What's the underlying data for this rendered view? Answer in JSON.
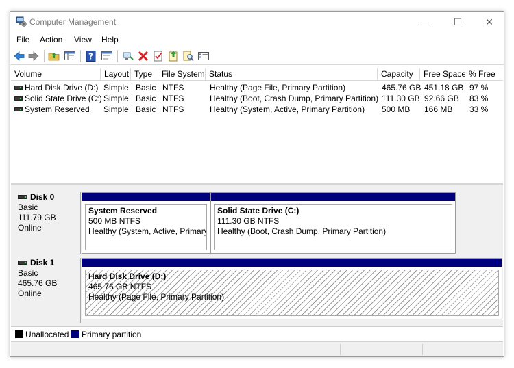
{
  "window": {
    "title": "Computer Management",
    "minimize_glyph": "—",
    "maximize_glyph": "☐",
    "close_glyph": "✕"
  },
  "menu": [
    "File",
    "Action",
    "View",
    "Help"
  ],
  "toolbar": {
    "icons": [
      "back-arrow-icon",
      "forward-arrow-icon",
      "up-folder-icon",
      "show-hide-tree-icon",
      "help-icon",
      "console-view-icon",
      "connect-icon",
      "delete-icon",
      "properties-icon",
      "export-icon",
      "search-icon",
      "details-icon"
    ]
  },
  "volumes": {
    "columns": [
      "Volume",
      "Layout",
      "Type",
      "File System",
      "Status",
      "Capacity",
      "Free Space",
      "% Free"
    ],
    "rows": [
      [
        "Hard Disk Drive (D:)",
        "Simple",
        "Basic",
        "NTFS",
        "Healthy (Page File, Primary Partition)",
        "465.76 GB",
        "451.18 GB",
        "97 %"
      ],
      [
        "Solid State Drive (C:)",
        "Simple",
        "Basic",
        "NTFS",
        "Healthy (Boot, Crash Dump, Primary Partition)",
        "111.30 GB",
        "92.66 GB",
        "83 %"
      ],
      [
        "System Reserved",
        "Simple",
        "Basic",
        "NTFS",
        "Healthy (System, Active, Primary Partition)",
        "500 MB",
        "166 MB",
        "33 %"
      ]
    ]
  },
  "disks": [
    {
      "name": "Disk 0",
      "type": "Basic",
      "size": "111.79 GB",
      "state": "Online",
      "partitions": [
        {
          "name": "System Reserved",
          "size_fs": "500 MB NTFS",
          "status": "Healthy (System, Active, Primary I"
        },
        {
          "name": "Solid State Drive  (C:)",
          "size_fs": "111.30 GB NTFS",
          "status": "Healthy (Boot, Crash Dump, Primary Partition)"
        }
      ]
    },
    {
      "name": "Disk 1",
      "type": "Basic",
      "size": "465.76 GB",
      "state": "Online",
      "partitions": [
        {
          "name": "Hard Disk Drive  (D:)",
          "size_fs": "465.76 GB NTFS",
          "status": "Healthy (Page File, Primary Partition)"
        }
      ]
    }
  ],
  "legend": {
    "unallocated_label": "Unallocated",
    "unallocated_color": "#000000",
    "primary_label": "Primary partition",
    "primary_color": "#00007f"
  }
}
